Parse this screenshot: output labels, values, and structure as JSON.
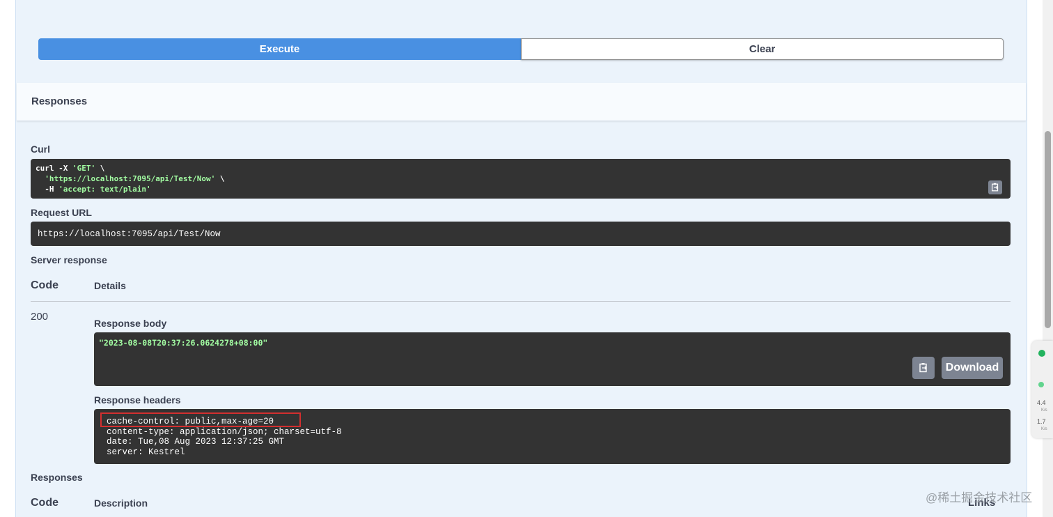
{
  "actions": {
    "execute_label": "Execute",
    "clear_label": "Clear"
  },
  "responses_section": {
    "title": "Responses"
  },
  "curl": {
    "label": "Curl",
    "line1_cmd": "curl -X ",
    "line1_method": "'GET'",
    "line1_tail": " \\",
    "line2_url": "'https://localhost:7095/api/Test/Now'",
    "line2_tail": " \\",
    "line3_flag": "  -H ",
    "line3_value": "'accept: text/plain'"
  },
  "request_url": {
    "label": "Request URL",
    "value": "https://localhost:7095/api/Test/Now"
  },
  "server_response": {
    "label": "Server response",
    "code_header": "Code",
    "details_header": "Details",
    "status_code": "200",
    "body_label": "Response body",
    "body_value": "\"2023-08-08T20:37:26.0624278+08:00\"",
    "download_label": "Download",
    "headers_label": "Response headers",
    "headers": [
      "cache-control: public,max-age=20",
      "content-type: application/json; charset=utf-8",
      "date: Tue,08 Aug 2023 12:37:25 GMT",
      "server: Kestrel"
    ]
  },
  "responses_table": {
    "label": "Responses",
    "code_header": "Code",
    "description_header": "Description",
    "links_header": "Links"
  },
  "network_widget": {
    "upload_value": "4.4",
    "upload_unit": "K/s",
    "download_value": "1.7",
    "download_unit": "K/s"
  },
  "watermark": "@稀土掘金技术社区",
  "colors": {
    "execute": "#4990e2",
    "code_bg": "#333333",
    "string": "#a2fca2",
    "highlight": "#d32f2f"
  }
}
